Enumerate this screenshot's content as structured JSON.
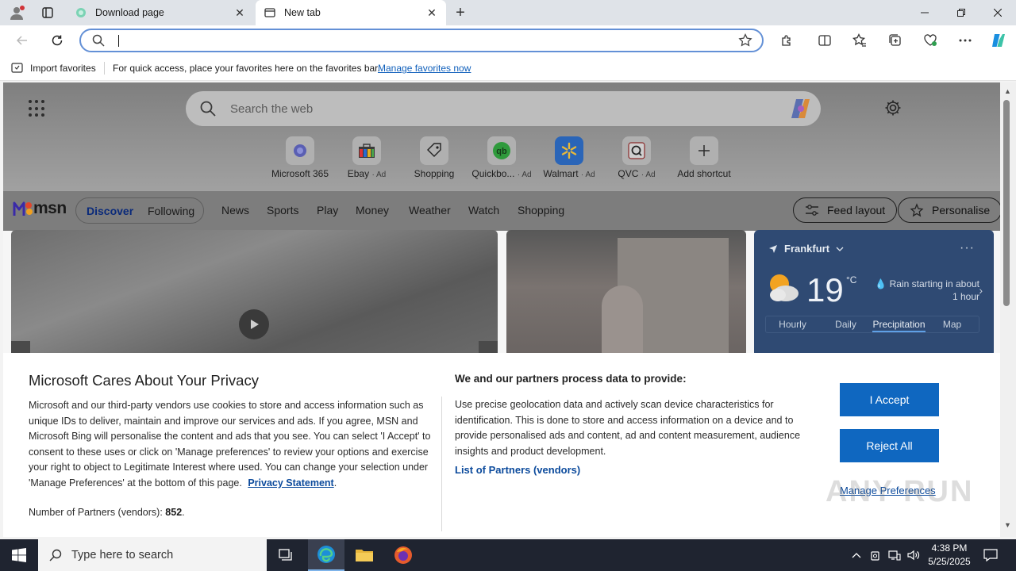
{
  "tabs": [
    {
      "title": "Download page"
    },
    {
      "title": "New tab"
    }
  ],
  "address": {
    "value": ""
  },
  "favorites_bar": {
    "import_label": "Import favorites",
    "message": "For quick access, place your favorites here on the favorites bar.",
    "manage_link": "Manage favorites now"
  },
  "newtab": {
    "search_placeholder": "Search the web",
    "shortcuts": [
      {
        "label": "Microsoft 365",
        "ad": ""
      },
      {
        "label": "Ebay",
        "ad": "· Ad"
      },
      {
        "label": "Shopping",
        "ad": ""
      },
      {
        "label": "Quickbo...",
        "ad": "· Ad"
      },
      {
        "label": "Walmart",
        "ad": "· Ad"
      },
      {
        "label": "QVC",
        "ad": "· Ad"
      },
      {
        "label": "Add shortcut",
        "ad": ""
      }
    ]
  },
  "msn": {
    "logo": "msn",
    "pill": {
      "discover": "Discover",
      "following": "Following"
    },
    "nav": [
      "News",
      "Sports",
      "Play",
      "Money",
      "Weather",
      "Watch",
      "Shopping"
    ],
    "feed_layout": "Feed layout",
    "personalise": "Personalise"
  },
  "weather": {
    "location": "Frankfurt",
    "temp": "19",
    "unit": "°C",
    "condition": "Rain starting in about 1 hour",
    "tabs": [
      "Hourly",
      "Daily",
      "Precipitation",
      "Map"
    ],
    "active_tab": "Precipitation"
  },
  "privacy": {
    "title": "Microsoft Cares About Your Privacy",
    "body": "Microsoft and our third-party vendors use cookies to store and access information such as unique IDs to deliver, maintain and improve our services and ads. If you agree, MSN and Microsoft Bing will personalise the content and ads that you see. You can select 'I Accept' to consent to these uses or click on 'Manage preferences' to review your options and exercise your right to object to Legitimate Interest where used.  You can change your selection under 'Manage Preferences' at the bottom of this page.",
    "privacy_link": "Privacy Statement",
    "partners_label": "Number of Partners (vendors):",
    "partners_count": "852",
    "right_title": "We and our partners process data to provide:",
    "right_body": "Use precise geolocation data and actively scan device characteristics for identification. This is done to store and access information on a device and to provide personalised ads and content, ad and content measurement, audience insights and product development.",
    "vendors_link": "List of Partners (vendors)",
    "accept": "I Accept",
    "reject": "Reject All",
    "manage": "Manage Preferences",
    "watermark": "ANY RUN"
  },
  "taskbar": {
    "search_placeholder": "Type here to search",
    "time": "4:38 PM",
    "date": "5/25/2025"
  },
  "colors": {
    "accent": "#0f67c0",
    "address_border": "#6390d6",
    "weather_card": "#2f4a73",
    "taskbar": "#1f2430"
  }
}
